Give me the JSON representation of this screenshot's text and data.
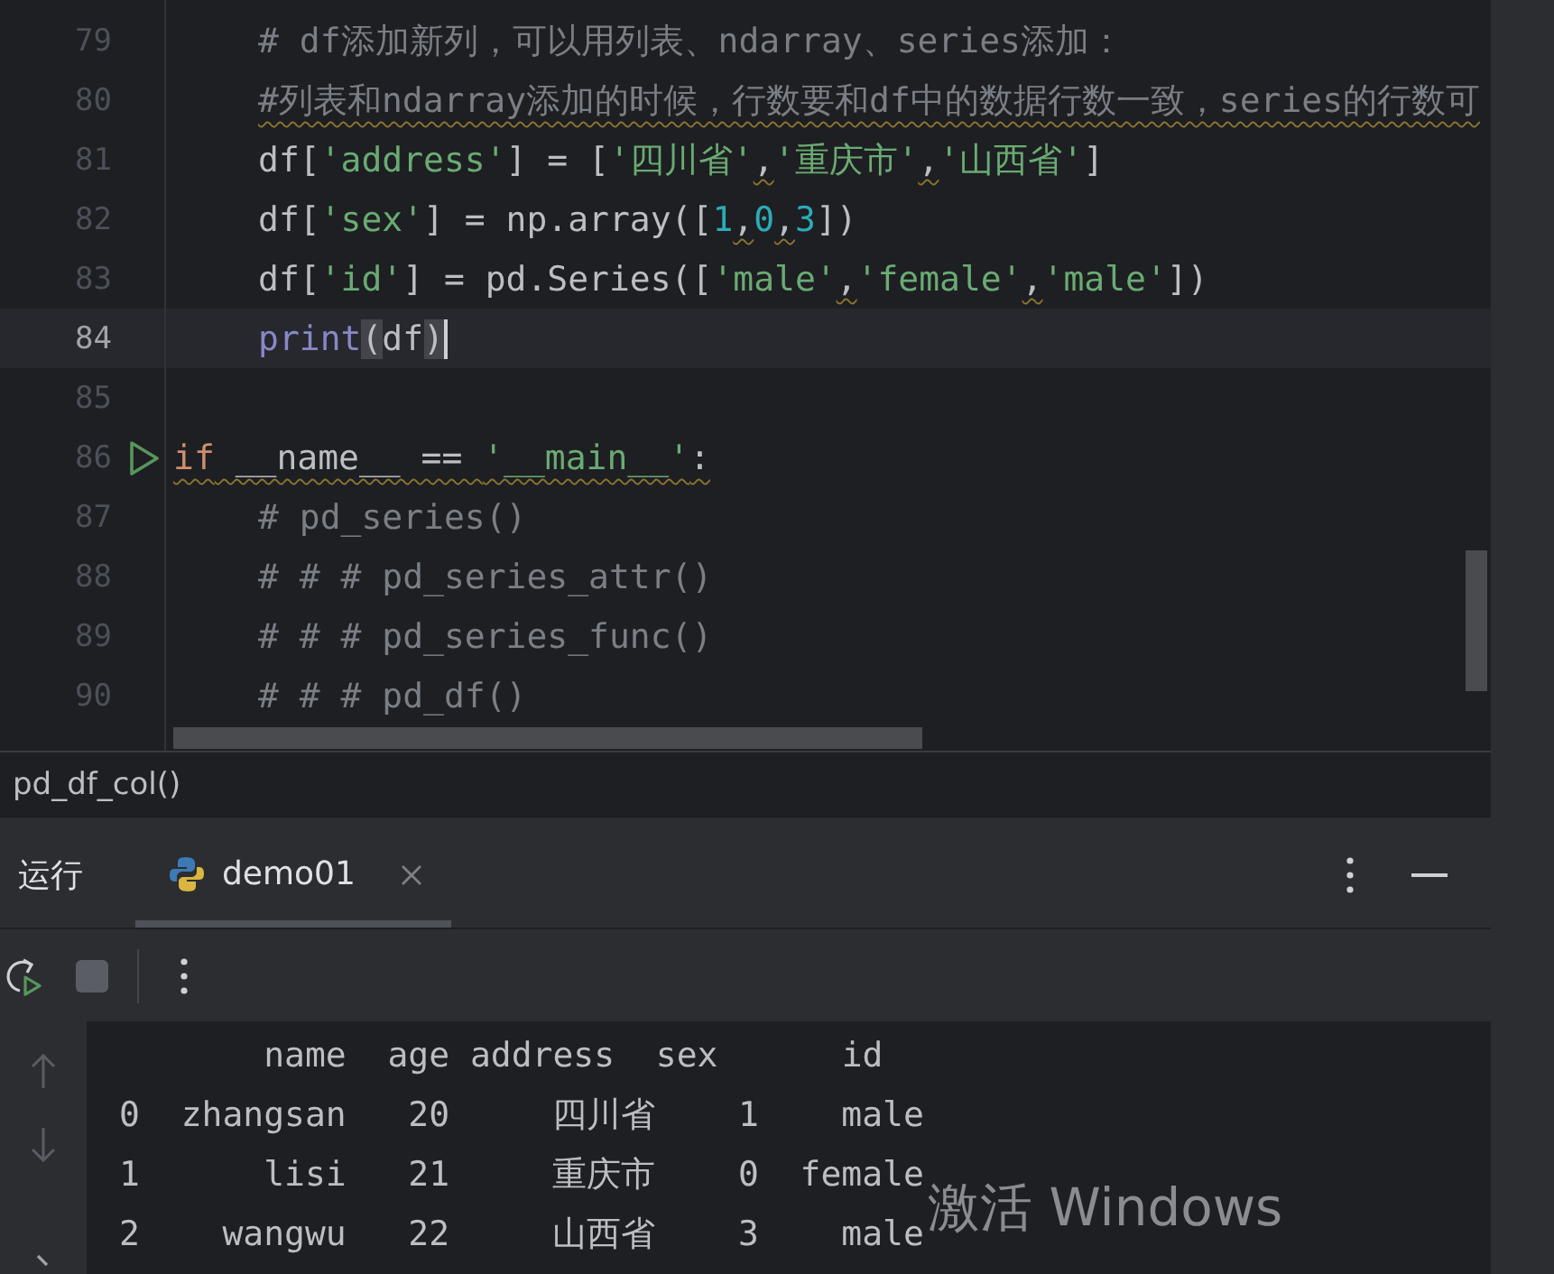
{
  "editor": {
    "lines": [
      {
        "number": "79",
        "current": false,
        "indented": true,
        "tokens": [
          {
            "kind": "comment",
            "text": "# df添加新列，可以用列表、ndarray、series添加："
          }
        ]
      },
      {
        "number": "80",
        "current": false,
        "warning": true,
        "indented": true,
        "tokens": [
          {
            "kind": "comment",
            "text": "#列表和ndarray添加的时候，行数要和df中的数据行数一致，series的行数可"
          }
        ]
      },
      {
        "number": "81",
        "current": false,
        "indented": true,
        "tokens": [
          {
            "kind": "plain",
            "text": "df["
          },
          {
            "kind": "string",
            "text": "'address'"
          },
          {
            "kind": "plain",
            "text": "] = ["
          },
          {
            "kind": "string",
            "text": "'四川省'"
          },
          {
            "kind": "comma-warn",
            "text": ","
          },
          {
            "kind": "string",
            "text": "'重庆市'"
          },
          {
            "kind": "comma-warn",
            "text": ","
          },
          {
            "kind": "string",
            "text": "'山西省'"
          },
          {
            "kind": "plain",
            "text": "]"
          }
        ]
      },
      {
        "number": "82",
        "current": false,
        "indented": true,
        "tokens": [
          {
            "kind": "plain",
            "text": "df["
          },
          {
            "kind": "string",
            "text": "'sex'"
          },
          {
            "kind": "plain",
            "text": "] = np.array(["
          },
          {
            "kind": "number",
            "text": "1"
          },
          {
            "kind": "comma-warn",
            "text": ","
          },
          {
            "kind": "number",
            "text": "0"
          },
          {
            "kind": "comma-warn",
            "text": ","
          },
          {
            "kind": "number",
            "text": "3"
          },
          {
            "kind": "plain",
            "text": "])"
          }
        ]
      },
      {
        "number": "83",
        "current": false,
        "indented": true,
        "tokens": [
          {
            "kind": "plain",
            "text": "df["
          },
          {
            "kind": "string",
            "text": "'id'"
          },
          {
            "kind": "plain",
            "text": "] = pd.Series(["
          },
          {
            "kind": "string",
            "text": "'male'"
          },
          {
            "kind": "comma-warn",
            "text": ","
          },
          {
            "kind": "string",
            "text": "'female'"
          },
          {
            "kind": "comma-warn",
            "text": ","
          },
          {
            "kind": "string",
            "text": "'male'"
          },
          {
            "kind": "plain",
            "text": "])"
          }
        ]
      },
      {
        "number": "84",
        "current": true,
        "indented": true,
        "tokens": [
          {
            "kind": "builtin",
            "text": "print"
          },
          {
            "kind": "brace-match",
            "text": "("
          },
          {
            "kind": "plain",
            "text": "df"
          },
          {
            "kind": "brace-match",
            "text": ")"
          }
        ]
      },
      {
        "number": "85",
        "current": false
      },
      {
        "number": "86",
        "current": false,
        "warning": true,
        "run": true,
        "indented": false,
        "tokens": [
          {
            "kind": "keyword",
            "text": "if"
          },
          {
            "kind": "plain",
            "text": " __name__ == "
          },
          {
            "kind": "string",
            "text": "'__main__'"
          },
          {
            "kind": "plain",
            "text": ":"
          }
        ]
      },
      {
        "number": "87",
        "current": false,
        "indented": true,
        "tokens": [
          {
            "kind": "comment",
            "text": "# pd_series()"
          }
        ]
      },
      {
        "number": "88",
        "current": false,
        "indented": true,
        "tokens": [
          {
            "kind": "comment",
            "text": "# # # pd_series_attr()"
          }
        ]
      },
      {
        "number": "89",
        "current": false,
        "indented": true,
        "tokens": [
          {
            "kind": "comment",
            "text": "# # # pd_series_func()"
          }
        ]
      },
      {
        "number": "90",
        "current": false,
        "indented": true,
        "tokens": [
          {
            "kind": "comment",
            "text": "# # # pd_df()"
          }
        ]
      }
    ]
  },
  "breadcrumb": "pd_df_col()",
  "run_panel": {
    "title": "运行",
    "tabs": [
      {
        "label": "demo01",
        "selected": true
      }
    ],
    "stop": {
      "disabled": true
    }
  },
  "console": {
    "lines": [
      "       name  age address  sex      id",
      "0  zhangsan   20     四川省    1    male",
      "1      lisi   21     重庆市    0  female",
      "2    wangwu   22     山西省    3    male"
    ]
  },
  "overlay": {
    "text": "激活 Windows"
  }
}
